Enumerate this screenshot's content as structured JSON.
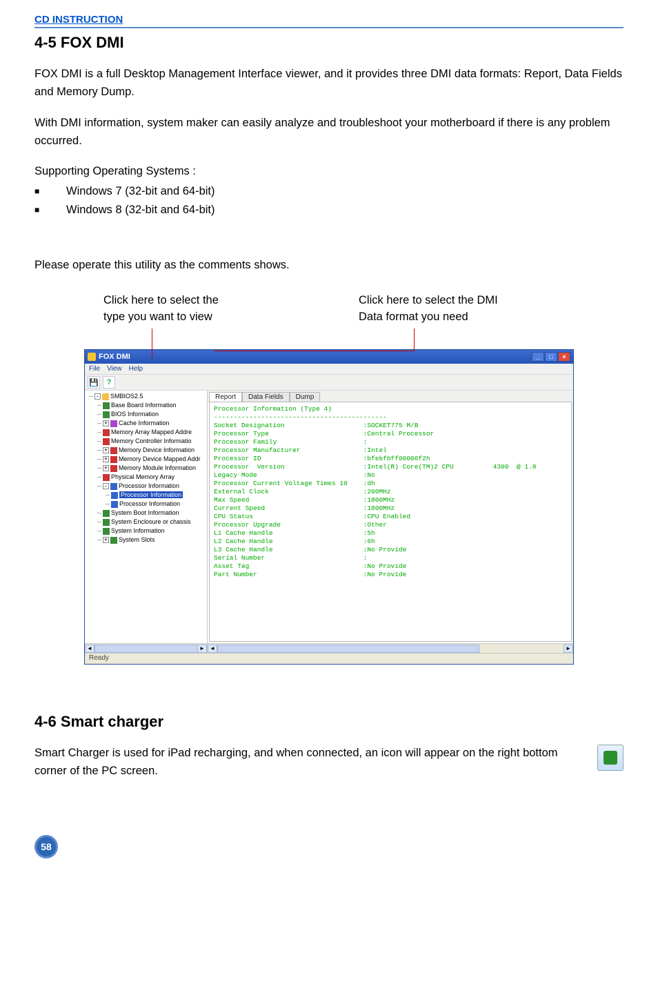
{
  "header": {
    "link": "CD INSTRUCTION"
  },
  "section1": {
    "title": "4-5 FOX DMI",
    "p1": "FOX DMI is a full Desktop Management Interface viewer, and it provides three DMI data formats: Report, Data Fields and Memory Dump.",
    "p2": "With DMI information, system maker can easily analyze and troubleshoot your motherboard if there is any problem occurred.",
    "supporting": "Supporting Operating Systems :",
    "os": [
      "Windows 7 (32-bit and 64-bit)",
      "Windows 8 (32-bit and 64-bit)"
    ],
    "p3": "Please operate this utility as the comments shows."
  },
  "callouts": {
    "left_l1": "Click here to select the",
    "left_l2": "type you want to view",
    "right_l1": "Click here to select the DMI",
    "right_l2": "Data format you need"
  },
  "win": {
    "title": "FOX DMI",
    "menu": [
      "File",
      "View",
      "Help"
    ],
    "tree": {
      "root": "SMBIOS2.5",
      "items": [
        "Base Board Information",
        "BIOS Information",
        "Cache Information",
        "Memory Array Mapped Addre",
        "Memory Controller Informatio",
        "Memory Device Information",
        "Memory Device Mapped Addr",
        "Memory Module Information",
        "Physical Memory Array",
        "Processor Information",
        "Processor Information",
        "Processor Information",
        "System Boot Information",
        "System Enclosure or chassis",
        "System Information",
        "System Slots"
      ],
      "selected": "Processor Information"
    },
    "tabs": {
      "report": "Report",
      "datafields": "Data Fields",
      "dump": "Dump"
    },
    "report": {
      "heading": "Processor Information (Type 4)",
      "rows": [
        {
          "l": "Socket Designation",
          "r": ":SOCKET775 M/B"
        },
        {
          "l": "Processor Type",
          "r": ":Central Processor"
        },
        {
          "l": "Processor Family",
          "r": ":"
        },
        {
          "l": "Processor Manufacturer",
          "r": ":Intel"
        },
        {
          "l": "Processor ID",
          "r": ":bfebfbff00006f2h"
        },
        {
          "l": "Processor  Version",
          "r": ":Intel(R) Core(TM)2 CPU          4300  @ 1.8"
        },
        {
          "l": "Legacy Mode",
          "r": ":No"
        },
        {
          "l": "Processor Current Voltage Times 10",
          "r": ":dh"
        },
        {
          "l": "External Clock",
          "r": ":200MHz"
        },
        {
          "l": "Max Speed",
          "r": ":1800MHz"
        },
        {
          "l": "Current Speed",
          "r": ":1800MHz"
        },
        {
          "l": "CPU Status",
          "r": ":CPU Enabled"
        },
        {
          "l": "Processor Upgrade",
          "r": ":Other"
        },
        {
          "l": "L1 Cache Handle",
          "r": ":5h"
        },
        {
          "l": "L2 Cache Handle",
          "r": ":6h"
        },
        {
          "l": "L3 Cache Handle",
          "r": ":No Provide"
        },
        {
          "l": "Serial Number",
          "r": ":"
        },
        {
          "l": "Asset Tag",
          "r": ":No Provide"
        },
        {
          "l": "Part Number",
          "r": ":No Provide"
        }
      ]
    },
    "status": "Ready"
  },
  "section2": {
    "title": "4-6 Smart charger",
    "p": "Smart Charger is used for iPad recharging, and when connected, an icon will appear on the right bottom corner of the PC screen."
  },
  "page_number": "58"
}
